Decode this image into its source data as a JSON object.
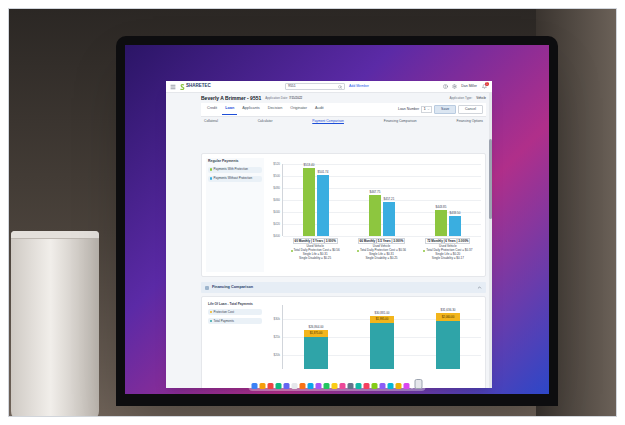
{
  "app": {
    "header": {
      "logo": "SHARETEC",
      "search": {
        "value": "9551"
      },
      "add_member": "Add Member",
      "user": "Dan Miller",
      "notification_count": "1"
    },
    "record": {
      "title": "Beverly A Brimmer - 9551",
      "application_date_label": "Application Date:",
      "application_date": "7/15/2022",
      "application_type_label": "Application Type:",
      "application_type": "Vehicle"
    },
    "tabs": [
      {
        "label": "Credit",
        "selected": false
      },
      {
        "label": "Loan",
        "selected": true
      },
      {
        "label": "Applicants",
        "selected": false
      },
      {
        "label": "Decision",
        "selected": false
      },
      {
        "label": "Originator",
        "selected": false
      },
      {
        "label": "Audit",
        "selected": false
      }
    ],
    "loan_number": {
      "label": "Loan Number",
      "value": "1"
    },
    "buttons": [
      {
        "label": "Save",
        "primary": true
      },
      {
        "label": "Cancel",
        "primary": false
      }
    ],
    "subtabs": [
      {
        "label": "Collateral",
        "selected": false
      },
      {
        "label": "Calculator",
        "selected": false
      },
      {
        "label": "Payment Comparison",
        "selected": true
      },
      {
        "label": "Financing Comparison",
        "selected": false
      },
      {
        "label": "Financing Options",
        "selected": false
      }
    ],
    "payment_chart": {
      "legend_title": "Regular Payments",
      "y_ticks": [
        "$520",
        "$500",
        "$480",
        "$460",
        "$440",
        "$420",
        "$400"
      ],
      "series": [
        {
          "name": "Payments With Protection",
          "color": "#8dc63f",
          "values": [
            513.4,
            467.75,
            443.85
          ],
          "labels": [
            "$513.40",
            "$467.75",
            "$443.85"
          ]
        },
        {
          "name": "Payments Without Protection",
          "color": "#3aaee0",
          "values": [
            501.74,
            457.21,
            433.5
          ],
          "labels": [
            "$501.74",
            "$457.21",
            "$433.50"
          ]
        }
      ],
      "groups": [
        {
          "caption": "60 Monthly | 5 Years | 3.000%",
          "type": "Used Vehicle",
          "lines": [
            "Total Daily Protection Cost = $0.56",
            "Single Life = $0.31",
            "Single Disability = $0.25"
          ]
        },
        {
          "caption": "66 Monthly | 5.5 Years | 3.000%",
          "type": "Used Vehicle",
          "lines": [
            "Total Daily Protection Cost = $0.56",
            "Single Life = $0.31",
            "Single Disability = $0.25"
          ]
        },
        {
          "caption": "72 Monthly | 6 Years | 3.000%",
          "type": "Used Vehicle",
          "lines": [
            "Total Daily Protection Cost = $0.37",
            "Single Life = $0.20",
            "Single Disability = $0.17"
          ]
        }
      ]
    },
    "financing_chart": {
      "title": "Financing Comparison",
      "expanded": true,
      "legend_title": "Life Of Loan - Total Payments",
      "y_ticks": [
        "$30k",
        "$25k",
        "$20k"
      ],
      "series": [
        {
          "name": "Protection Cost",
          "color": "#f2b51c",
          "values": [
            1875,
            1995,
            2060
          ],
          "labels": [
            "$1,875.00",
            "$1,995.00",
            "$2,060.00"
          ]
        },
        {
          "name": "Total Payments",
          "color": "#2fa4a8",
          "values": [
            24989,
            28886,
            29576.3
          ]
        }
      ],
      "totals": [
        "$26,864.00",
        "$30,881.00",
        "$31,636.30"
      ]
    }
  }
}
